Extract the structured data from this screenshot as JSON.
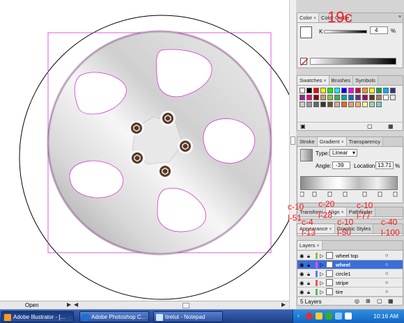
{
  "canvas": {
    "status_label": "Open"
  },
  "color_panel": {
    "tabs": [
      "Color",
      "Color Guide"
    ],
    "channel_label": "K",
    "k_value": "4",
    "percent": "%"
  },
  "swatches_panel": {
    "tabs": [
      "Swatches",
      "Brushes",
      "Symbols"
    ],
    "colors": [
      "#ffffff",
      "#000000",
      "#ff0000",
      "#ffff00",
      "#00ff00",
      "#00ffff",
      "#0000ff",
      "#ff00ff",
      "#c8102e",
      "#f7941d",
      "#fff200",
      "#00a651",
      "#00aeef",
      "#2e3192",
      "#92278f",
      "#ec008c",
      "#8b0000",
      "#c69c6d",
      "#8dc63f",
      "#39b54a",
      "#00a99d",
      "#0072bc",
      "#662d91",
      "#9e005d",
      "#603913",
      "#a67c52",
      "#ffffff",
      "#e6e6e6",
      "#cccccc",
      "#999999",
      "#666666",
      "#333333",
      "#754c24",
      "#c7b299",
      "#f26522",
      "#f7977a",
      "#fbaf5d",
      "#fff799",
      "#a3d39c",
      "#7accc8"
    ]
  },
  "gradient_panel": {
    "tabs": [
      "Stroke",
      "Gradient",
      "Transparency"
    ],
    "type_label": "Type:",
    "type_value": "Linear",
    "angle_label": "Angle:",
    "angle_value": "-39",
    "location_label": "Location:",
    "location_value": "13.71",
    "percent": "%"
  },
  "align_panel": {
    "tabs": [
      "Transform",
      "Align",
      "Pathfinder"
    ]
  },
  "appearance_panel": {
    "tabs": [
      "Appearance",
      "Graphic Styles"
    ]
  },
  "layers_panel": {
    "tabs": [
      "Layers"
    ],
    "layers": [
      {
        "name": "wheel top",
        "color": "#8fbf4f",
        "selected": false
      },
      {
        "name": "wheel",
        "color": "#ff47ff",
        "selected": true
      },
      {
        "name": "circle1",
        "color": "#4f7fff",
        "selected": false
      },
      {
        "name": "stripe",
        "color": "#ff4f4f",
        "selected": false
      },
      {
        "name": "tire",
        "color": "#4fbf4f",
        "selected": false
      }
    ],
    "count_label": "5 Layers"
  },
  "annotations": {
    "big": "19c",
    "a1": "c-10",
    "a2": "c-20",
    "a3": "c-10",
    "a4": "l-51",
    "a5": "l-28",
    "a6": "l-77",
    "a7": "c-4",
    "a8": "c-10",
    "a9": "c-40",
    "a10": "l-13",
    "a11": "l-50",
    "a12": "l-100"
  },
  "taskbar": {
    "items": [
      "Adobe Illustrator - [...",
      "Adobe Photoshop C...",
      "tiretut - Notepad"
    ],
    "clock": "10:16 AM"
  },
  "colors": {
    "selection": "#d633d6",
    "taskbar": "#2d55a5"
  }
}
